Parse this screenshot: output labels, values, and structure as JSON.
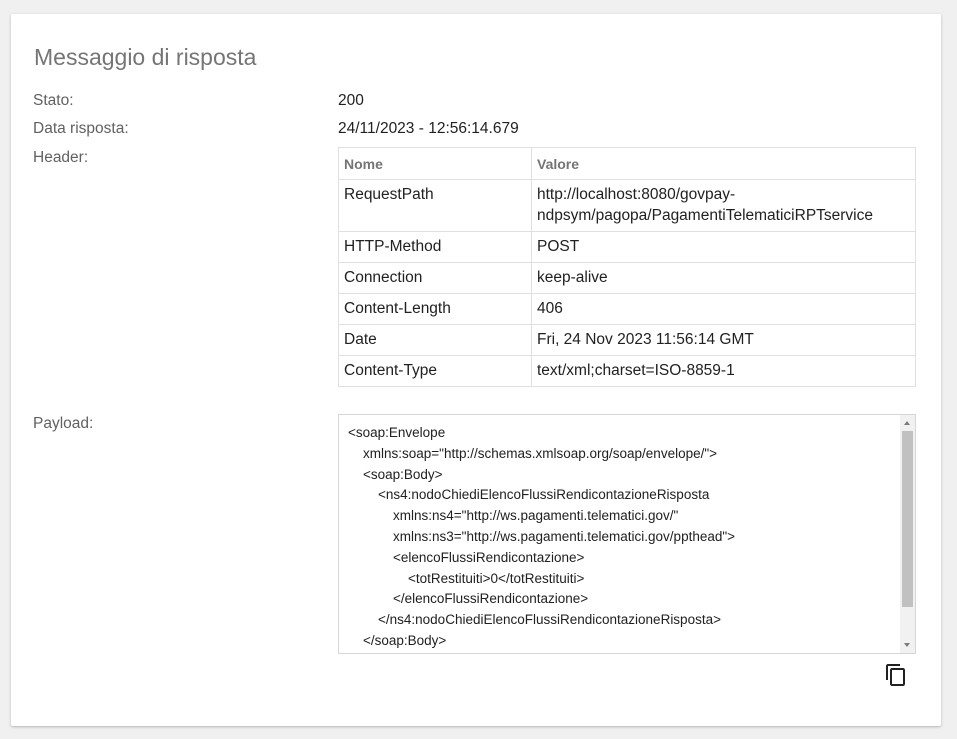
{
  "card": {
    "title": "Messaggio di risposta"
  },
  "fields": {
    "stato_label": "Stato:",
    "stato_value": "200",
    "data_label": "Data risposta:",
    "data_value": "24/11/2023 - 12:56:14.679",
    "header_label": "Header:",
    "payload_label": "Payload:"
  },
  "header_table": {
    "columns": [
      "Nome",
      "Valore"
    ],
    "rows": [
      {
        "name": "RequestPath",
        "value": "http://localhost:8080/govpay-\nndpsym/pagopa/PagamentiTelematiciRPTservice"
      },
      {
        "name": "HTTP-Method",
        "value": "POST"
      },
      {
        "name": "Connection",
        "value": "keep-alive"
      },
      {
        "name": "Content-Length",
        "value": "406"
      },
      {
        "name": "Date",
        "value": "Fri, 24 Nov 2023 11:56:14 GMT"
      },
      {
        "name": "Content-Type",
        "value": "text/xml;charset=ISO-8859-1"
      }
    ]
  },
  "payload": {
    "text": "<soap:Envelope\n    xmlns:soap=\"http://schemas.xmlsoap.org/soap/envelope/\">\n    <soap:Body>\n        <ns4:nodoChiediElencoFlussiRendicontazioneRisposta\n            xmlns:ns4=\"http://ws.pagamenti.telematici.gov/\"\n            xmlns:ns3=\"http://ws.pagamenti.telematici.gov/ppthead\">\n            <elencoFlussiRendicontazione>\n                <totRestituiti>0</totRestituiti>\n            </elencoFlussiRendicontazione>\n        </ns4:nodoChiediElencoFlussiRendicontazioneRisposta>\n    </soap:Body>"
  },
  "icons": {
    "copy": "copy-icon"
  }
}
